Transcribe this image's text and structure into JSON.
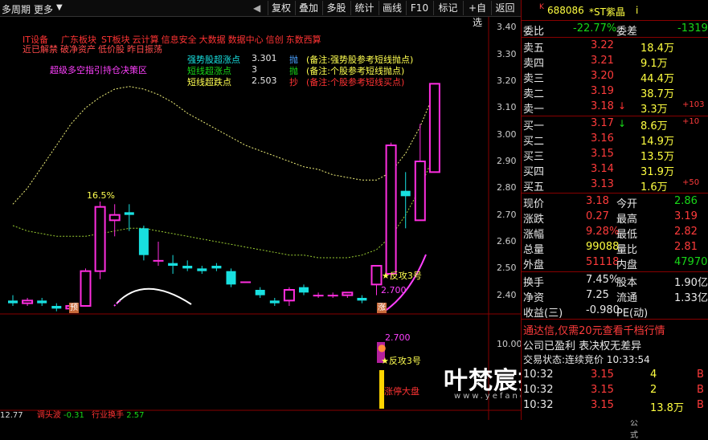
{
  "toolbar": {
    "period": "多周期",
    "more": "更多",
    "buttons": [
      "复权",
      "叠加",
      "多股",
      "统计",
      "画线",
      "F10",
      "标记",
      "+自选",
      "返回"
    ]
  },
  "chart_area": {
    "sectors_line1": [
      "IT设备",
      "广东板块",
      "ST板块",
      "云计算",
      "信息安全",
      "大数据",
      "数据中心",
      "信创",
      "东数西算"
    ],
    "sectors_line2": [
      "近已解禁",
      "破净资产",
      "低价股",
      "昨日振荡"
    ],
    "strategy_label": "超级多空指引持仓决策区",
    "indicators": [
      {
        "name": "强势股超涨点",
        "value": "3.301",
        "signal": "抛",
        "note": "(备注:强势股参考短线抛点)"
      },
      {
        "name": "短线超涨点",
        "value": "3",
        "signal": "抛",
        "note": "(备注:个股参考短线抛点)"
      },
      {
        "name": "短线超跌点",
        "value": "2.503",
        "signal": "抄",
        "note": "(备注:个股参考短线买点)"
      }
    ],
    "y_ticks": [
      "3.40",
      "3.30",
      "3.20",
      "3.10",
      "3.00",
      "2.90",
      "2.80",
      "2.70",
      "2.60",
      "2.50",
      "2.40"
    ],
    "lower_y_tick": "10.00",
    "annotations": {
      "pct": "16.5%",
      "fangong": "★反攻3号",
      "price_mark": "2.700",
      "marker_yu": "预",
      "marker_zhang": "涨",
      "lower_price": "2.700",
      "lower_fangong": "★反攻3号",
      "lower_zhangting": "涨停大盘"
    },
    "bottom_bar": {
      "left": "12.77",
      "indicator": "调头波",
      "value1": "-0.31",
      "label2": "行业换手",
      "value2": "2.57"
    },
    "watermark": {
      "title": "叶梵宸指标公式网",
      "url": "www.yefanchen.com",
      "sub": "指 标 公 式"
    }
  },
  "chart_data": {
    "type": "candlestick",
    "ylim": [
      2.33,
      3.44
    ],
    "candles": [
      [
        2.38,
        2.37,
        2.4,
        2.36
      ],
      [
        2.37,
        2.38,
        2.39,
        2.36
      ],
      [
        2.38,
        2.37,
        2.39,
        2.36
      ],
      [
        2.36,
        2.35,
        2.37,
        2.34
      ],
      [
        2.35,
        2.36,
        2.37,
        2.34
      ],
      [
        2.36,
        2.49,
        2.5,
        2.36
      ],
      [
        2.49,
        2.73,
        2.75,
        2.46
      ],
      [
        2.68,
        2.7,
        2.74,
        2.62
      ],
      [
        2.71,
        2.7,
        2.74,
        2.64
      ],
      [
        2.65,
        2.55,
        2.66,
        2.53
      ],
      [
        2.53,
        2.53,
        2.6,
        2.51
      ],
      [
        2.52,
        2.51,
        2.55,
        2.48
      ],
      [
        2.51,
        2.5,
        2.53,
        2.49
      ],
      [
        2.5,
        2.49,
        2.51,
        2.48
      ],
      [
        2.51,
        2.5,
        2.52,
        2.49
      ],
      [
        2.49,
        2.44,
        2.5,
        2.43
      ],
      [
        2.45,
        2.45,
        2.45,
        2.45
      ],
      [
        2.42,
        2.4,
        2.43,
        2.39
      ],
      [
        2.38,
        2.37,
        2.39,
        2.36
      ],
      [
        2.38,
        2.42,
        2.43,
        2.36
      ],
      [
        2.43,
        2.41,
        2.44,
        2.4
      ],
      [
        2.4,
        2.4,
        2.41,
        2.39
      ],
      [
        2.4,
        2.4,
        2.41,
        2.39
      ],
      [
        2.4,
        2.41,
        2.41,
        2.39
      ],
      [
        2.39,
        2.38,
        2.4,
        2.37
      ],
      [
        2.44,
        2.51,
        2.51,
        2.4
      ],
      [
        2.48,
        2.96,
        2.97,
        2.46
      ],
      [
        2.79,
        2.77,
        2.86,
        2.65
      ],
      [
        2.68,
        2.9,
        3.04,
        2.68
      ],
      [
        2.86,
        3.19,
        3.19,
        2.86
      ]
    ],
    "ma_upper": [
      2.74,
      2.8,
      2.88,
      2.96,
      3.04,
      3.1,
      3.14,
      3.17,
      3.18,
      3.17,
      3.15,
      3.12,
      3.08,
      3.05,
      3.02,
      2.99,
      2.96,
      2.94,
      2.92,
      2.9,
      2.88,
      2.87,
      2.85,
      2.84,
      2.83,
      2.83,
      2.86,
      2.93,
      3.03,
      3.16
    ],
    "ma_lower": [
      2.66,
      2.64,
      2.63,
      2.62,
      2.62,
      2.62,
      2.63,
      2.64,
      2.65,
      2.65,
      2.64,
      2.63,
      2.62,
      2.61,
      2.6,
      2.59,
      2.58,
      2.57,
      2.56,
      2.55,
      2.55,
      2.54,
      2.54,
      2.54,
      2.55,
      2.57,
      2.62,
      2.7,
      2.8,
      2.93
    ]
  },
  "quote_panel": {
    "stock_code": "688086",
    "stock_name": "*ST紫晶",
    "weibi_label": "委比",
    "weibi_value": "-22.77%",
    "weicha_label": "委差",
    "weicha_value": "-1319",
    "sells": [
      {
        "label": "卖五",
        "price": "3.22",
        "vol": "18.4万",
        "extra": ""
      },
      {
        "label": "卖四",
        "price": "3.21",
        "vol": "9.1万",
        "extra": ""
      },
      {
        "label": "卖三",
        "price": "3.20",
        "vol": "44.4万",
        "extra": ""
      },
      {
        "label": "卖二",
        "price": "3.19",
        "vol": "38.7万",
        "extra": ""
      },
      {
        "label": "卖一",
        "price": "3.18",
        "vol": "3.3万",
        "extra": "+103"
      }
    ],
    "buys": [
      {
        "label": "买一",
        "price": "3.17",
        "vol": "8.6万",
        "extra": "+10"
      },
      {
        "label": "买二",
        "price": "3.16",
        "vol": "14.9万",
        "extra": ""
      },
      {
        "label": "买三",
        "price": "3.15",
        "vol": "13.5万",
        "extra": ""
      },
      {
        "label": "买四",
        "price": "3.14",
        "vol": "31.9万",
        "extra": ""
      },
      {
        "label": "买五",
        "price": "3.13",
        "vol": "1.6万",
        "extra": "+50"
      }
    ],
    "stats": [
      {
        "l1": "现价",
        "v1": "3.18",
        "l2": "今开",
        "v2": "2.86"
      },
      {
        "l1": "涨跌",
        "v1": "0.27",
        "l2": "最高",
        "v2": "3.19"
      },
      {
        "l1": "涨幅",
        "v1": "9.28%",
        "l2": "最低",
        "v2": "2.82"
      },
      {
        "l1": "总量",
        "v1": "99088",
        "l2": "量比",
        "v2": "2.81"
      },
      {
        "l1": "外盘",
        "v1": "51118",
        "l2": "内盘",
        "v2": "47970"
      }
    ],
    "stats2": [
      {
        "l1": "换手",
        "v1": "7.45%",
        "l2": "股本",
        "v2": "1.90亿"
      },
      {
        "l1": "净资",
        "v1": "7.25",
        "l2": "流通",
        "v2": "1.33亿"
      },
      {
        "l1": "收益(三)",
        "v1": "-0.980",
        "l2": "PE(动)",
        "v2": ""
      }
    ],
    "ad": "通达信,仅需20元查看千档行情",
    "info": "公司已盈利 表决权无差异",
    "trade_status": "交易状态:连续竞价 10:33:54",
    "ticks": [
      {
        "time": "10:32",
        "price": "3.15",
        "vol": "4",
        "dir": "B"
      },
      {
        "time": "10:32",
        "price": "3.15",
        "vol": "2",
        "dir": "B"
      },
      {
        "time": "10:32",
        "price": "3.15",
        "vol": "13.8万",
        "dir": "B"
      }
    ]
  },
  "colors": {
    "up": "#ff2ee0",
    "down": "#18e0e0",
    "ma_upper": "#f0f07a",
    "ma_lower": "#9acd32"
  }
}
